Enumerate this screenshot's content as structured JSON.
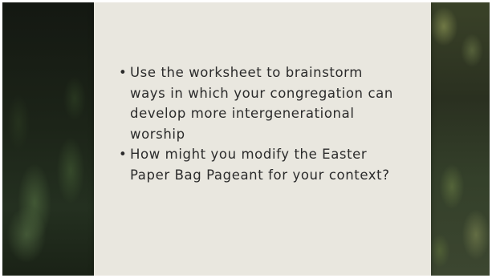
{
  "slide": {
    "bullets": [
      {
        "marker": "•",
        "text": "Use the worksheet to brainstorm ways in which your congregation can develop more intergenerational worship"
      },
      {
        "marker": "•",
        "text": "How might you modify the Easter Paper Bag Pageant for your context?"
      }
    ]
  },
  "colors": {
    "card_background": "#e9e7df",
    "text": "#2b2b2b",
    "frame": "#0d0d0d"
  }
}
